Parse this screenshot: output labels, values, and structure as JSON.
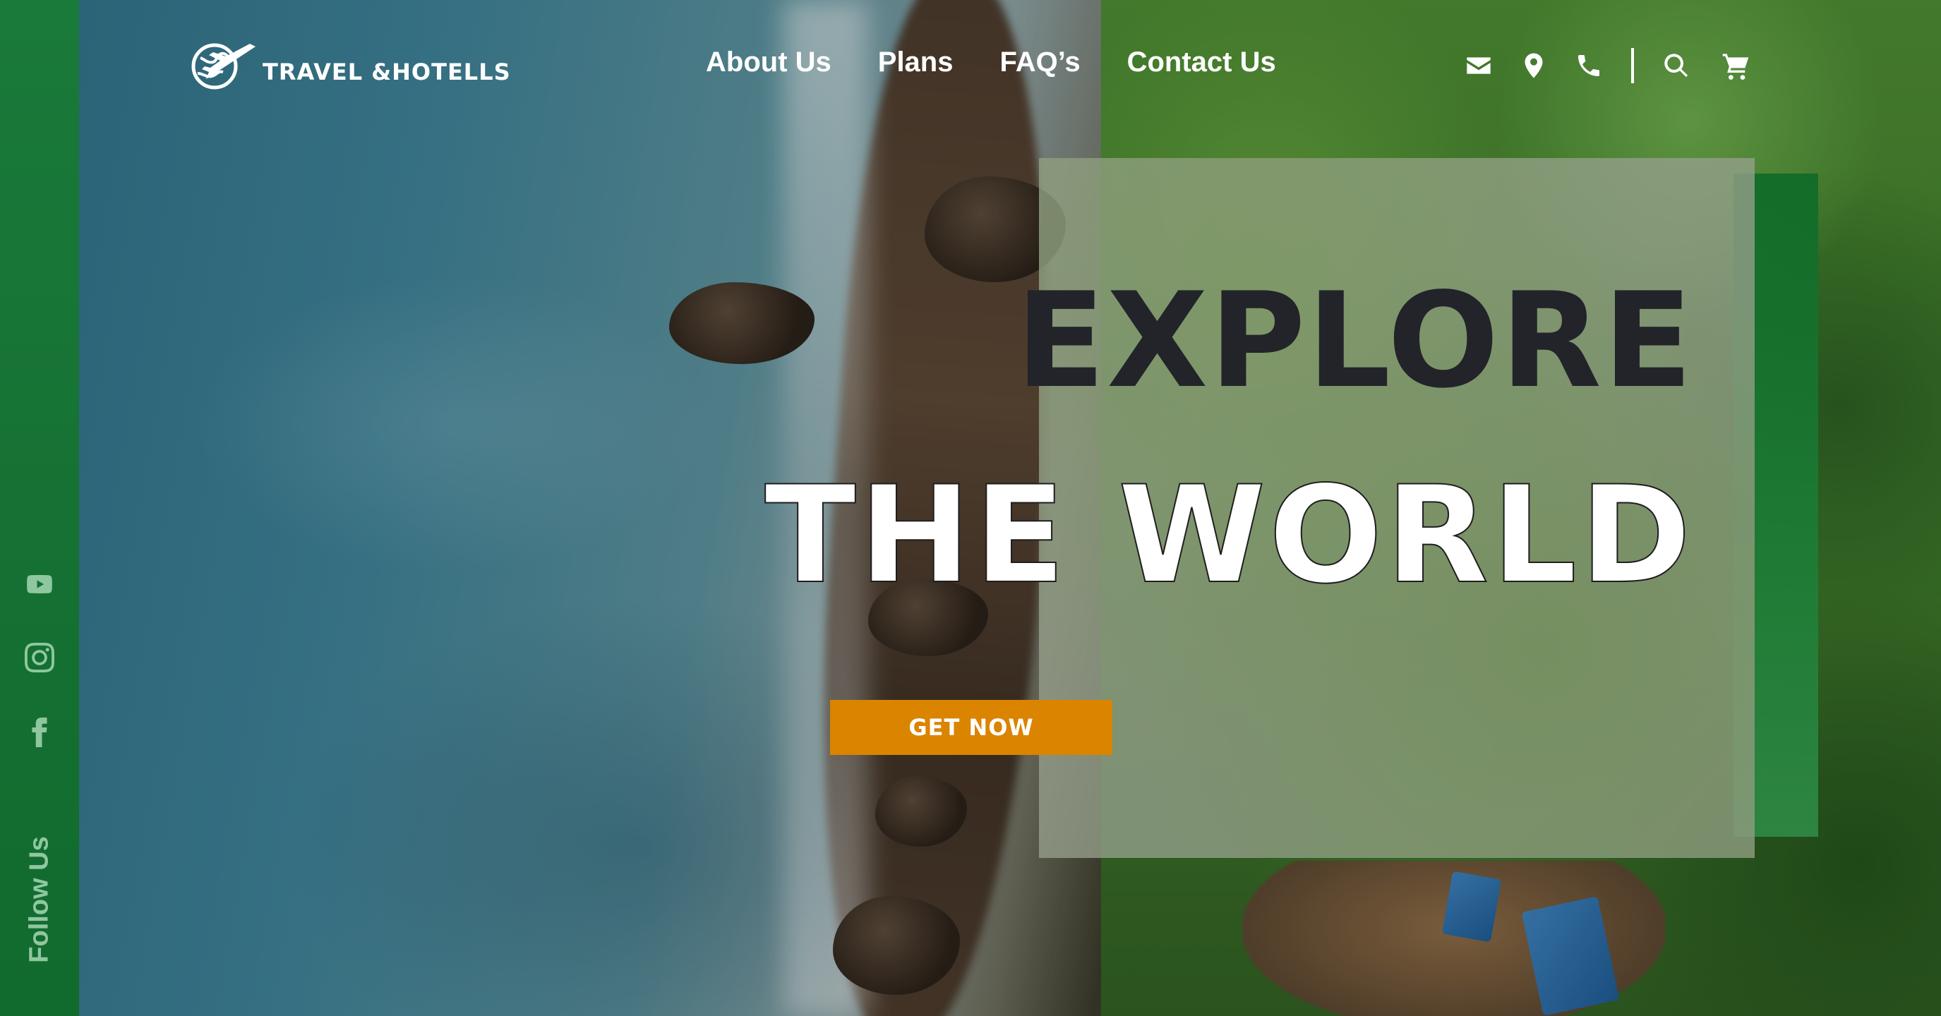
{
  "brand": {
    "logo_text": "TRAVEL &HOTELLS",
    "logo_icon": "globe-airplane-icon"
  },
  "nav": {
    "items": [
      {
        "label": "About Us"
      },
      {
        "label": "Plans"
      },
      {
        "label": "FAQ’s"
      },
      {
        "label": "Contact Us"
      }
    ]
  },
  "header_tools": {
    "icons": [
      "envelope-icon",
      "map-pin-icon",
      "phone-icon",
      "search-icon",
      "cart-icon"
    ]
  },
  "sidebar": {
    "social_icons": [
      "youtube-icon",
      "instagram-icon",
      "facebook-icon"
    ],
    "follow_label": "Follow Us"
  },
  "hero": {
    "headline_line1": "EXPLORE",
    "headline_line2": "THE WORLD",
    "cta_label": "GET NOW"
  },
  "colors": {
    "sidebar_green": "#1a7a3a",
    "accent_green": "#0f6b27",
    "cta_orange": "#db8400",
    "headline_dark": "#22242a",
    "nav_text": "#ffffff"
  }
}
